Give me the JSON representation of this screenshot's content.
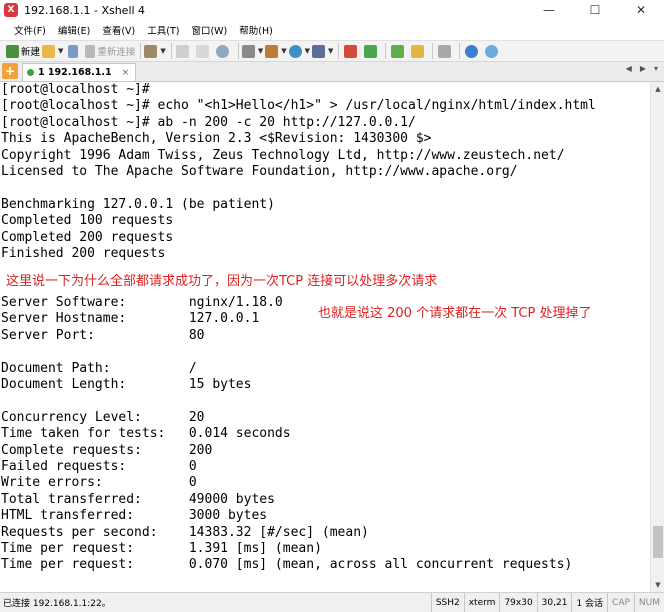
{
  "window": {
    "title": "192.168.1.1 - Xshell 4",
    "minimize": "—",
    "maximize": "☐",
    "close": "✕"
  },
  "menu": [
    "文件(F)",
    "编辑(E)",
    "查看(V)",
    "工具(T)",
    "窗口(W)",
    "帮助(H)"
  ],
  "toolbar": {
    "new_label": "新建",
    "reconnect_label": "重新连接"
  },
  "tab": {
    "add": "+",
    "label": "1 192.168.1.1",
    "close": "×",
    "prev": "◀",
    "next": "▶",
    "list": "▾"
  },
  "terminal": {
    "lines": [
      "[root@localhost ~]#",
      "[root@localhost ~]# echo \"<h1>Hello</h1>\" > /usr/local/nginx/html/index.html",
      "[root@localhost ~]# ab -n 200 -c 20 http://127.0.0.1/",
      "This is ApacheBench, Version 2.3 <$Revision: 1430300 $>",
      "Copyright 1996 Adam Twiss, Zeus Technology Ltd, http://www.zeustech.net/",
      "Licensed to The Apache Software Foundation, http://www.apache.org/",
      "",
      "Benchmarking 127.0.0.1 (be patient)",
      "Completed 100 requests",
      "Completed 200 requests",
      "Finished 200 requests",
      "",
      "",
      "Server Software:        nginx/1.18.0",
      "Server Hostname:        127.0.0.1",
      "Server Port:            80",
      "",
      "Document Path:          /",
      "Document Length:        15 bytes",
      "",
      "Concurrency Level:      20",
      "Time taken for tests:   0.014 seconds",
      "Complete requests:      200",
      "Failed requests:        0",
      "Write errors:           0",
      "Total transferred:      49000 bytes",
      "HTML transferred:       3000 bytes",
      "Requests per second:    14383.32 [#/sec] (mean)",
      "Time per request:       1.391 [ms] (mean)",
      "Time per request:       0.070 [ms] (mean, across all concurrent requests)"
    ],
    "annotation_1": "这里说一下为什么全部都请求成功了，因为一次TCP 连接可以处理多次请求",
    "annotation_2": "也就是说这 200 个请求都在一次 TCP 处理掉了",
    "annotation_color": "#e02020"
  },
  "statusbar": {
    "connection": "已连接 192.168.1.1:22。",
    "protocol": "SSH2",
    "term": "xterm",
    "size": "79x30",
    "cursor": "30,21",
    "sessions": "1 会话",
    "caps": "CAP",
    "num": "NUM"
  }
}
